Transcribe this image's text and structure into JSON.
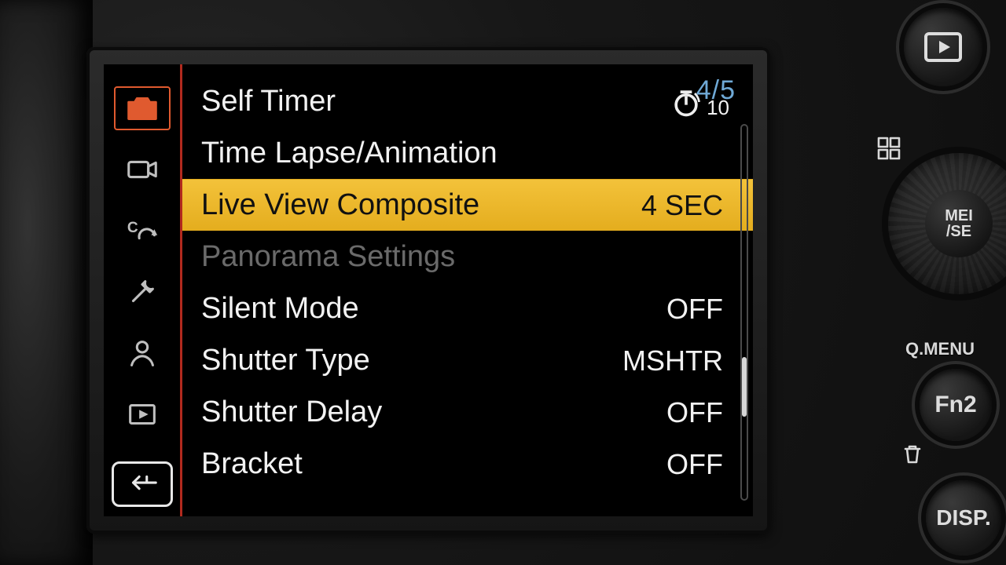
{
  "page_indicator": "4/5",
  "sidebar": {
    "active_index": 0,
    "icons": [
      "camera-icon",
      "video-icon",
      "wrench-c-icon",
      "wrench-icon",
      "person-icon",
      "playback-icon"
    ]
  },
  "menu": {
    "items": [
      {
        "label": "Self Timer",
        "value_icon": "self-timer-icon",
        "value_sub": "10",
        "selected": false,
        "disabled": false
      },
      {
        "label": "Time Lapse/Animation",
        "value": "",
        "selected": false,
        "disabled": false
      },
      {
        "label": "Live View Composite",
        "value": "4 SEC",
        "selected": true,
        "disabled": false
      },
      {
        "label": "Panorama Settings",
        "value": "",
        "selected": false,
        "disabled": true
      },
      {
        "label": "Silent Mode",
        "value": "OFF",
        "selected": false,
        "disabled": false
      },
      {
        "label": "Shutter Type",
        "value": "MSHTR",
        "selected": false,
        "disabled": false
      },
      {
        "label": "Shutter Delay",
        "value": "OFF",
        "selected": false,
        "disabled": false
      },
      {
        "label": "Bracket",
        "value": "OFF",
        "selected": false,
        "disabled": false
      }
    ]
  },
  "physical": {
    "qmenu": "Q.MENU",
    "fn2": "Fn2",
    "disp": "DISP.",
    "dial_center": "MEI\n/SE"
  }
}
